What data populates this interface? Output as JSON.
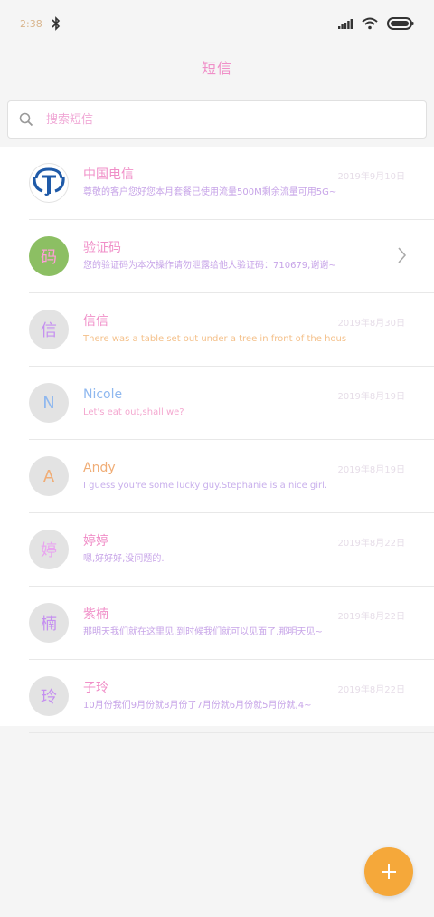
{
  "status_bar": {
    "time": "2:38"
  },
  "header": {
    "title": "短信"
  },
  "search": {
    "placeholder": "搜索短信"
  },
  "threads": [
    {
      "name": "中国电信",
      "preview": "尊敬的客户您好您本月套餐已使用流量500M剩余流量可用5G~",
      "date": "2019年9月10日",
      "avatar_text": "",
      "avatar_type": "telecom",
      "name_color": "#f08fc8",
      "preview_color": "#c7a4e8"
    },
    {
      "name": "验证码",
      "preview": "您的验证码为本次操作请勿泄露给他人验证码：710679,谢谢~",
      "date": "",
      "avatar_text": "码",
      "avatar_type": "green",
      "name_color": "#f08fc8",
      "preview_color": "#c7a4e8"
    },
    {
      "name": "信信",
      "preview": "There was a table set out under a tree in front of the hous",
      "date": "2019年8月30日",
      "avatar_text": "信",
      "avatar_type": "gray",
      "name_color": "#f08fc8",
      "preview_color": "#f4c08a"
    },
    {
      "name": "Nicole",
      "preview": "Let's eat out,shall we?",
      "date": "2019年8月19日",
      "avatar_text": "N",
      "avatar_type": "gray",
      "name_color": "#8fb8ef",
      "preview_color": "#f4a8d0"
    },
    {
      "name": "Andy",
      "preview": "I guess you're some lucky guy.Stephanie is a nice girl.",
      "date": "2019年8月19日",
      "avatar_text": "A",
      "avatar_type": "gray",
      "name_color": "#f0ad76",
      "preview_color": "#c9b0ec"
    },
    {
      "name": "婷婷",
      "preview": "嗯,好好好,没问题的.",
      "date": "2019年8月22日",
      "avatar_text": "婷",
      "avatar_type": "gray",
      "name_color": "#f08fc8",
      "preview_color": "#c7a4e8"
    },
    {
      "name": "紫楠",
      "preview": "那明天我们就在这里见,到时候我们就可以见面了,那明天见~",
      "date": "2019年8月22日",
      "avatar_text": "楠",
      "avatar_type": "gray",
      "name_color": "#f08fc8",
      "preview_color": "#c7a4e8"
    },
    {
      "name": "子玲",
      "preview": "10月份我们9月份就8月份了7月份就6月份就5月份就,4~",
      "date": "2019年8月22日",
      "avatar_text": "玲",
      "avatar_type": "gray",
      "name_color": "#f08fc8",
      "preview_color": "#c7a4e8"
    }
  ],
  "colors": {
    "fab": "#f5a83a",
    "accent": "#f08fc8",
    "telecom_blue": "#1f5aa8"
  }
}
